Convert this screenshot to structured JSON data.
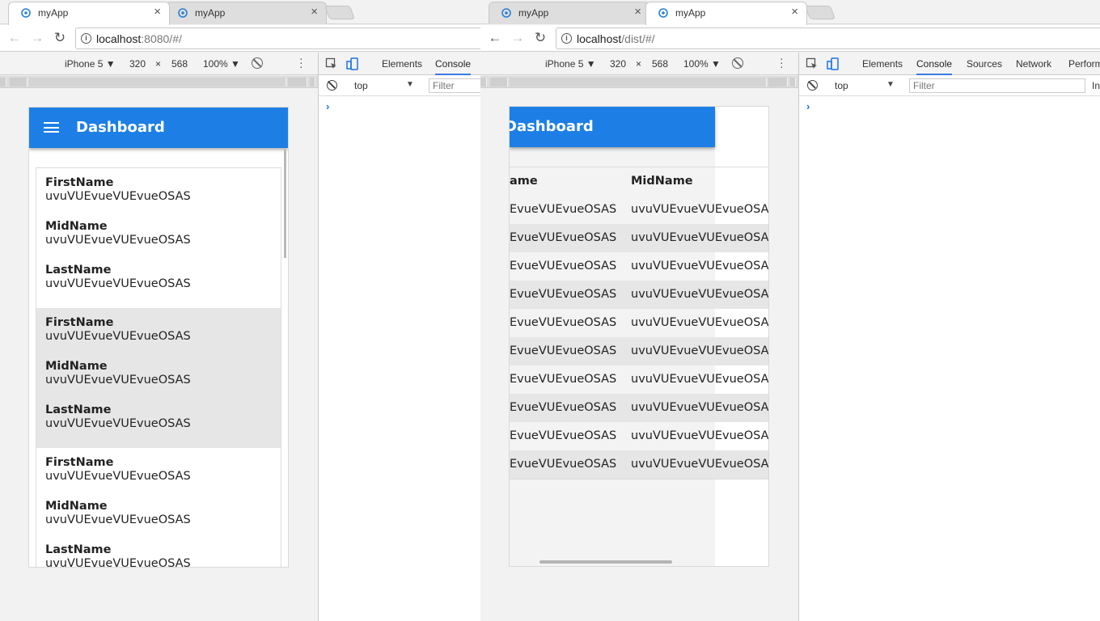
{
  "left_window": {
    "tabs": [
      {
        "title": "myApp",
        "close": "×"
      },
      {
        "title": "myApp",
        "close": "×"
      }
    ],
    "url_host": "localhost",
    "url_rest": ":8080/#/",
    "device": {
      "name": "iPhone 5 ▼",
      "width": "320",
      "x": "×",
      "height": "568",
      "zoom": "100% ▼"
    },
    "devtools_tabs": [
      "Elements",
      "Console"
    ],
    "context": "top",
    "filter_placeholder": "Filter",
    "prompt": "›",
    "app": {
      "title": "Dashboard",
      "groups": [
        {
          "fields": [
            {
              "label": "FirstName",
              "value": "uvuVUEvueVUEvueOSAS"
            },
            {
              "label": "MidName",
              "value": "uvuVUEvueVUEvueOSAS"
            },
            {
              "label": "LastName",
              "value": "uvuVUEvueVUEvueOSAS"
            }
          ]
        },
        {
          "fields": [
            {
              "label": "FirstName",
              "value": "uvuVUEvueVUEvueOSAS"
            },
            {
              "label": "MidName",
              "value": "uvuVUEvueVUEvueOSAS"
            },
            {
              "label": "LastName",
              "value": "uvuVUEvueVUEvueOSAS"
            }
          ]
        },
        {
          "fields": [
            {
              "label": "FirstName",
              "value": "uvuVUEvueVUEvueOSAS"
            },
            {
              "label": "MidName",
              "value": "uvuVUEvueVUEvueOSAS"
            },
            {
              "label": "LastName",
              "value": "uvuVUEvueVUEvueOSAS"
            }
          ]
        }
      ]
    }
  },
  "right_window": {
    "tabs": [
      {
        "title": "myApp",
        "close": "×"
      },
      {
        "title": "myApp",
        "close": "×"
      }
    ],
    "url_host": "localhost",
    "url_rest": "/dist/#/",
    "device": {
      "name": "iPhone 5 ▼",
      "width": "320",
      "x": "×",
      "height": "568",
      "zoom": "100% ▼"
    },
    "devtools_tabs": [
      "Elements",
      "Console",
      "Sources",
      "Network",
      "Perform"
    ],
    "context": "top",
    "filter_placeholder": "Filter",
    "filter_extra": "In",
    "prompt": "›",
    "app": {
      "title": "Dashboard",
      "headers": [
        "ame",
        "MidName"
      ],
      "rows": [
        [
          "EvueVUEvueOSAS",
          "uvuVUEvueVUEvueOSAS"
        ],
        [
          "EvueVUEvueOSAS",
          "uvuVUEvueVUEvueOSAS"
        ],
        [
          "EvueVUEvueOSAS",
          "uvuVUEvueVUEvueOSAS"
        ],
        [
          "EvueVUEvueOSAS",
          "uvuVUEvueVUEvueOSAS"
        ],
        [
          "EvueVUEvueOSAS",
          "uvuVUEvueVUEvueOSAS"
        ],
        [
          "EvueVUEvueOSAS",
          "uvuVUEvueVUEvueOSAS"
        ],
        [
          "EvueVUEvueOSAS",
          "uvuVUEvueVUEvueOSAS"
        ],
        [
          "EvueVUEvueOSAS",
          "uvuVUEvueVUEvueOSAS"
        ],
        [
          "EvueVUEvueOSAS",
          "uvuVUEvueVUEvueOSAS"
        ],
        [
          "EvueVUEvueOSAS",
          "uvuVUEvueVUEvueOSAS"
        ]
      ]
    }
  },
  "colors": {
    "appbar": "#1d7fe6",
    "accent": "#3b7ae0",
    "row_alt": "#e6e6e6"
  },
  "icons": [
    "app-logo-icon",
    "close-icon",
    "back-arrow-icon",
    "forward-arrow-icon",
    "reload-icon",
    "info-icon",
    "rotate-icon",
    "more-vertical-icon",
    "inspect-element-icon",
    "device-toolbar-icon",
    "clear-console-icon",
    "menu-icon"
  ]
}
